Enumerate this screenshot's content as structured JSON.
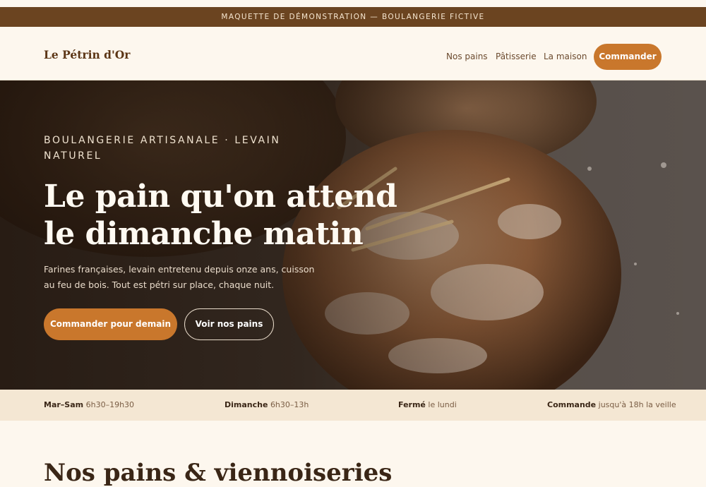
{
  "banner": {
    "text": "MAQUETTE DE DÉMONSTRATION — BOULANGERIE FICTIVE"
  },
  "nav": {
    "brand": "Le Pétrin d'Or",
    "links": [
      "Nos pains",
      "Pâtisserie",
      "La maison"
    ],
    "cta": "Commander"
  },
  "hero": {
    "eyebrow": "BOULANGERIE ARTISANALE · LEVAIN NATUREL",
    "title_line1": "Le pain qu'on attend",
    "title_line2": "le dimanche matin",
    "lead": "Farines françaises, levain entretenu depuis onze ans, cuisson au feu de bois. Tout est pétri sur place, chaque nuit.",
    "primary_button": "Commander pour demain",
    "secondary_button": "Voir nos pains"
  },
  "hours": [
    {
      "label": "Mar–Sam",
      "value": "6h30–19h30"
    },
    {
      "label": "Dimanche",
      "value": "6h30–13h"
    },
    {
      "label": "Fermé",
      "value": "le lundi"
    },
    {
      "label": "Commande",
      "value": "jusqu'à 18h la veille"
    }
  ],
  "section": {
    "title": "Nos pains & viennoiseries"
  },
  "colors": {
    "accent": "#c9772c",
    "banner": "#6b4420",
    "background": "#fdf7ee",
    "hours_bar": "#f4e7d3"
  }
}
